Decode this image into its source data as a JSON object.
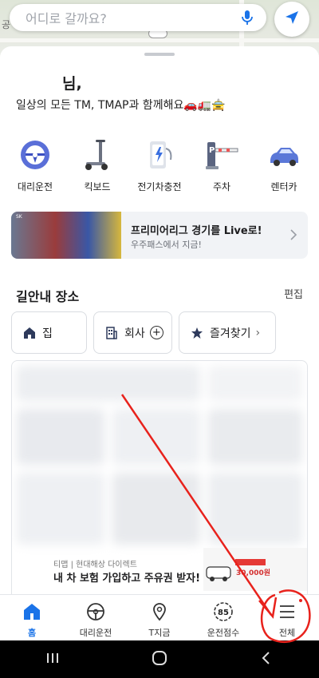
{
  "map": {
    "edge_label": "공"
  },
  "search": {
    "placeholder": "어디로 갈까요?"
  },
  "greeting": {
    "name": "님,",
    "subtitle": "일상의 모든 TM, TMAP과 함께해요🚗🚛🚖"
  },
  "services": [
    {
      "label": "대리운전",
      "icon": "steering-wheel-icon"
    },
    {
      "label": "킥보드",
      "icon": "kickboard-icon"
    },
    {
      "label": "전기차충전",
      "icon": "ev-charger-icon"
    },
    {
      "label": "주차",
      "icon": "parking-icon"
    },
    {
      "label": "렌터카",
      "icon": "rental-car-icon"
    }
  ],
  "banner": {
    "brand_tag": "SK",
    "title": "프리미어리그 경기를 Live로!",
    "subtitle": "우주패스에서 지금!"
  },
  "places": {
    "title": "길안내 장소",
    "edit_label": "편집",
    "chips": [
      {
        "label": "집",
        "icon": "home-icon"
      },
      {
        "label": "회사",
        "icon": "building-icon"
      },
      {
        "label": "즐겨찾기",
        "icon": "star-icon"
      }
    ]
  },
  "ad": {
    "source": "티맵 | 현대해상 다이렉트",
    "message": "내 차 보험 가입하고 주유권 받자!",
    "promo_amount": "30,000원"
  },
  "bottom_nav": [
    {
      "label": "홈",
      "icon": "home-icon",
      "active": true
    },
    {
      "label": "대리운전",
      "icon": "steering-wheel-icon"
    },
    {
      "label": "T지금",
      "icon": "location-pin-icon"
    },
    {
      "label": "운전점수",
      "icon": "score-icon",
      "badge": "85"
    },
    {
      "label": "전체",
      "icon": "menu-icon"
    }
  ],
  "colors": {
    "accent": "#1a73e8",
    "annotation": "#e8221c"
  }
}
